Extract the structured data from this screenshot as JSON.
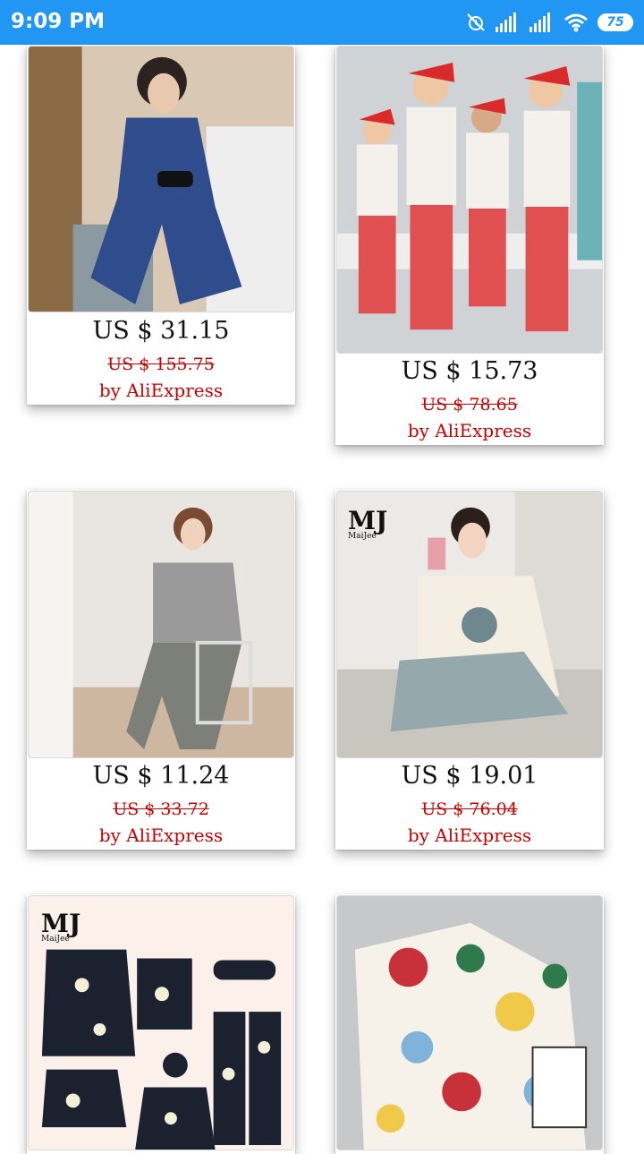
{
  "status_bar": {
    "time": "9:09 PM",
    "battery": "75"
  },
  "products": [
    {
      "price": "US $ 31.15",
      "original_price": "US $ 155.75",
      "seller": "by AliExpress",
      "image": "blue velvet pajama set"
    },
    {
      "price": "US $ 15.73",
      "original_price": "US $ 78.65",
      "seller": "by AliExpress",
      "image": "family christmas striped pajamas"
    },
    {
      "price": "US $ 11.24",
      "original_price": "US $ 33.72",
      "seller": "by AliExpress",
      "image": "grey pajama set with camo pants"
    },
    {
      "price": "US $ 19.01",
      "original_price": "US $ 76.04",
      "seller": "by AliExpress",
      "image": "cream bear fleece pajamas"
    },
    {
      "price": "",
      "original_price": "",
      "seller": "",
      "image": "black floral 7-piece pajama set",
      "brand": "MJ",
      "brand_sub": "MaiJee"
    },
    {
      "price": "",
      "original_price": "",
      "seller": "",
      "image": "colorful dot print flannel pajamas"
    }
  ],
  "brand_mj": {
    "logo": "MJ",
    "sub": "MaiJee"
  },
  "colors": {
    "status_bar": "#2196F3",
    "sale_red": "#cc0000"
  }
}
